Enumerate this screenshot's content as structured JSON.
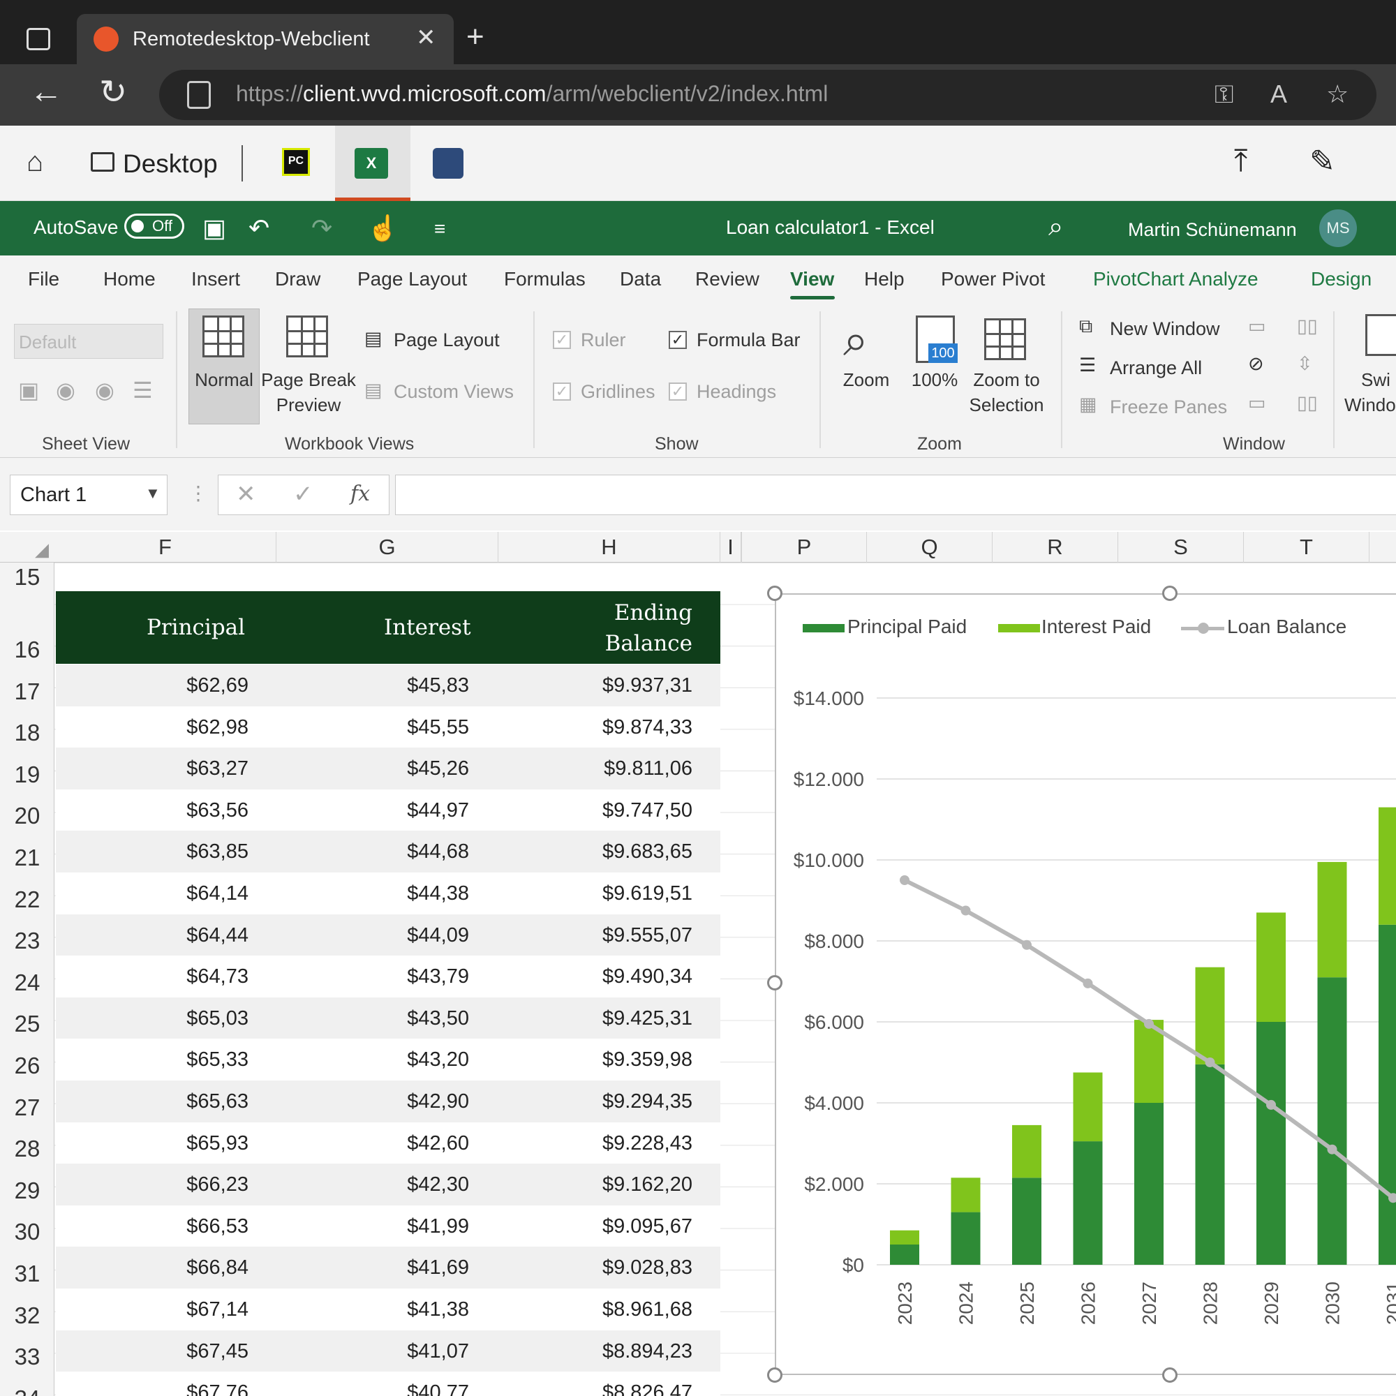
{
  "browser": {
    "tab_title": "Remotedesktop-Webclient",
    "url_prefix": "https://",
    "url_host": "client.wvd.microsoft.com",
    "url_path": "/arm/webclient/v2/index.html"
  },
  "rd_toolbar": {
    "desktop_label": "Desktop",
    "pycharm_label": "PC"
  },
  "excel": {
    "autosave_label": "AutoSave",
    "autosave_state": "Off",
    "doc_title": "Loan calculator1  -  Excel",
    "user_name": "Martin Schünemann",
    "user_initials": "MS"
  },
  "ribbon_tabs": [
    "File",
    "Home",
    "Insert",
    "Draw",
    "Page Layout",
    "Formulas",
    "Data",
    "Review",
    "View",
    "Help",
    "Power Pivot",
    "PivotChart Analyze",
    "Design"
  ],
  "ribbon": {
    "sheet_view_select": "Default",
    "sheet_view_group": "Sheet View",
    "normal": "Normal",
    "page_break_1": "Page Break",
    "page_break_2": "Preview",
    "page_layout": "Page Layout",
    "custom_views": "Custom Views",
    "workbook_views_group": "Workbook Views",
    "ruler": "Ruler",
    "formula_bar": "Formula Bar",
    "gridlines": "Gridlines",
    "headings": "Headings",
    "show_group": "Show",
    "zoom": "Zoom",
    "zoom_100": "100%",
    "zoom_100_badge": "100",
    "zoom_sel_1": "Zoom to",
    "zoom_sel_2": "Selection",
    "zoom_group": "Zoom",
    "new_window": "New Window",
    "arrange_all": "Arrange All",
    "freeze_panes": "Freeze Panes",
    "switch_1": "Swi",
    "switch_2": "Windo",
    "window_group": "Window"
  },
  "formula": {
    "namebox": "Chart 1",
    "fx": "fx"
  },
  "columns": [
    "F",
    "G",
    "H",
    "I",
    "P",
    "Q",
    "R",
    "S",
    "T"
  ],
  "rows": [
    "15",
    "16",
    "17",
    "18",
    "19",
    "20",
    "21",
    "22",
    "23",
    "24",
    "25",
    "26",
    "27",
    "28",
    "29",
    "30",
    "31",
    "32",
    "33",
    "34"
  ],
  "table": {
    "headers": {
      "principal": "Principal",
      "interest": "Interest",
      "ending_1": "Ending",
      "ending_2": "Balance"
    },
    "data": [
      [
        "$62,69",
        "$45,83",
        "$9.937,31"
      ],
      [
        "$62,98",
        "$45,55",
        "$9.874,33"
      ],
      [
        "$63,27",
        "$45,26",
        "$9.811,06"
      ],
      [
        "$63,56",
        "$44,97",
        "$9.747,50"
      ],
      [
        "$63,85",
        "$44,68",
        "$9.683,65"
      ],
      [
        "$64,14",
        "$44,38",
        "$9.619,51"
      ],
      [
        "$64,44",
        "$44,09",
        "$9.555,07"
      ],
      [
        "$64,73",
        "$43,79",
        "$9.490,34"
      ],
      [
        "$65,03",
        "$43,50",
        "$9.425,31"
      ],
      [
        "$65,33",
        "$43,20",
        "$9.359,98"
      ],
      [
        "$65,63",
        "$42,90",
        "$9.294,35"
      ],
      [
        "$65,93",
        "$42,60",
        "$9.228,43"
      ],
      [
        "$66,23",
        "$42,30",
        "$9.162,20"
      ],
      [
        "$66,53",
        "$41,99",
        "$9.095,67"
      ],
      [
        "$66,84",
        "$41,69",
        "$9.028,83"
      ],
      [
        "$67,14",
        "$41,38",
        "$8.961,68"
      ],
      [
        "$67,45",
        "$41,07",
        "$8.894,23"
      ],
      [
        "$67,76",
        "$40,77",
        "$8.826,47"
      ]
    ]
  },
  "chart_data": {
    "type": "bar",
    "categories": [
      "2023",
      "2024",
      "2025",
      "2026",
      "2027",
      "2028",
      "2029",
      "2030",
      "2031"
    ],
    "series": [
      {
        "name": "Principal Paid",
        "kind": "stacked-bar",
        "color": "#2e8b36",
        "values": [
          500,
          1300,
          2150,
          3050,
          4000,
          4950,
          6000,
          7100,
          8400
        ]
      },
      {
        "name": "Interest Paid",
        "kind": "stacked-bar",
        "color": "#80c41c",
        "values": [
          350,
          850,
          1300,
          1700,
          2050,
          2400,
          2700,
          2850,
          2900
        ]
      },
      {
        "name": "Loan Balance",
        "kind": "line",
        "color": "#b8b8b8",
        "values": [
          9500,
          8750,
          7900,
          6950,
          5950,
          5000,
          3950,
          2850,
          1650
        ]
      }
    ],
    "y_ticks": [
      "$0",
      "$2.000",
      "$4.000",
      "$6.000",
      "$8.000",
      "$10.000",
      "$12.000",
      "$14.000"
    ],
    "ylim": [
      0,
      14000
    ],
    "legend_position": "top",
    "grid": true
  }
}
